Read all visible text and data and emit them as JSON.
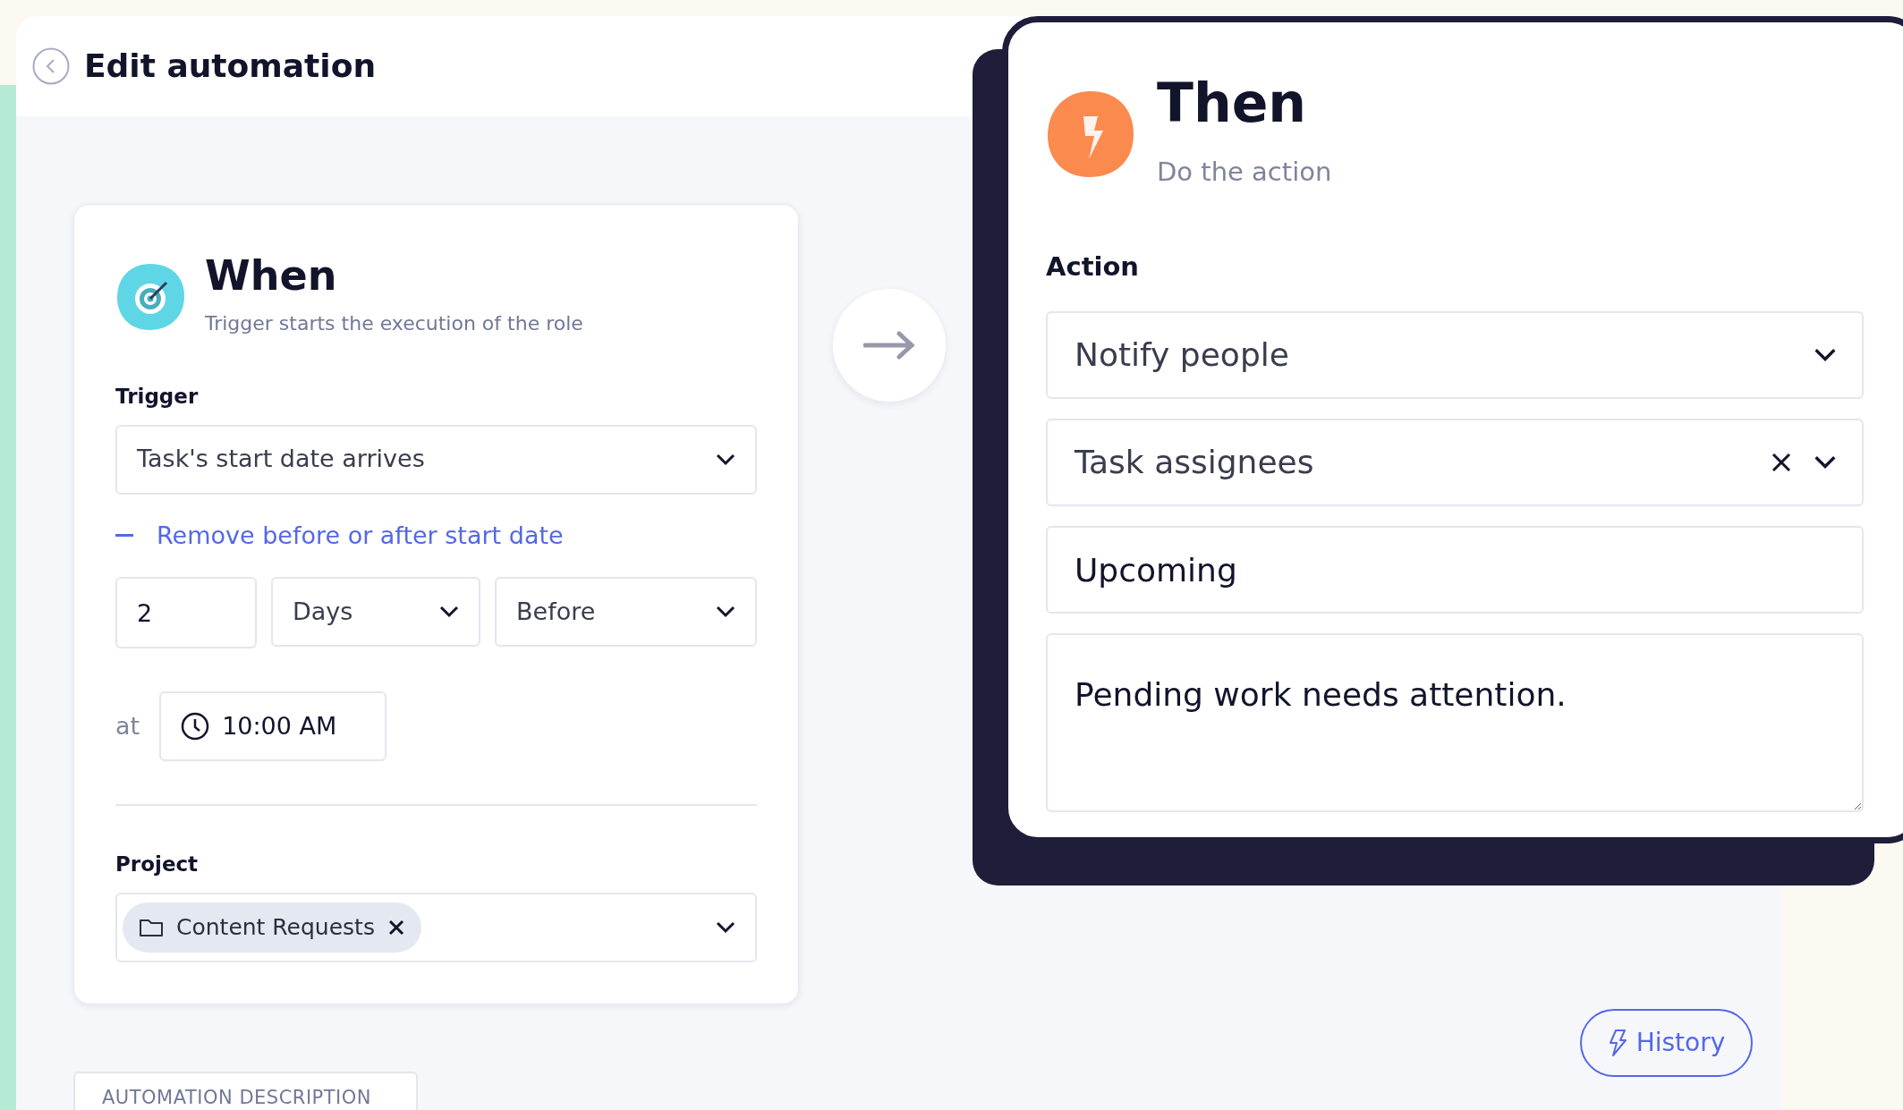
{
  "header": {
    "title": "Edit automation"
  },
  "when": {
    "title": "When",
    "subtitle": "Trigger starts the execution of the role",
    "trigger_label": "Trigger",
    "trigger": "Task's start date arrives",
    "remove_link": "Remove before or after start date",
    "amount": "2",
    "unit": "Days",
    "direction": "Before",
    "at_label": "at",
    "time": "10:00 AM",
    "project_label": "Project",
    "project_chips": [
      {
        "label": "Content Requests"
      }
    ]
  },
  "then": {
    "title": "Then",
    "subtitle": "Do the action",
    "action_label": "Action",
    "action": "Notify people",
    "recipients": "Task assignees",
    "subject": "Upcoming",
    "message": "Pending work needs attention."
  },
  "history_button": "History",
  "description_tab": "AUTOMATION DESCRIPTION"
}
